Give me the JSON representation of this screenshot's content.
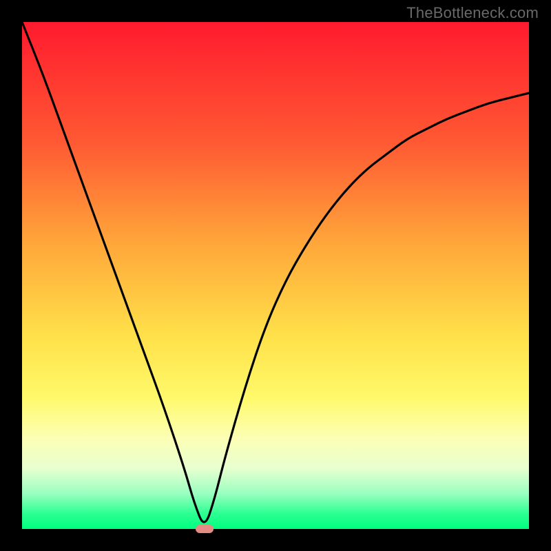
{
  "watermark": "TheBottleneck.com",
  "colors": {
    "frame": "#000000",
    "curve": "#000000",
    "marker": "#e38b84"
  },
  "chart_data": {
    "type": "line",
    "title": "",
    "xlabel": "",
    "ylabel": "",
    "xlim": [
      0,
      100
    ],
    "ylim": [
      0,
      100
    ],
    "grid": false,
    "legend": false,
    "notes": "V-shaped bottleneck curve. The vertical axis roughly reads as mismatch (%) mapped onto a red→green gradient (red top ≈ severe, green bottom ≈ balanced). Minimum sits near x≈36.",
    "series": [
      {
        "name": "bottleneck-curve",
        "x": [
          0,
          4,
          8,
          12,
          16,
          20,
          24,
          28,
          32,
          34,
          36,
          38,
          40,
          44,
          48,
          52,
          56,
          60,
          64,
          68,
          72,
          76,
          80,
          84,
          88,
          92,
          96,
          100
        ],
        "values": [
          100,
          90,
          79,
          68,
          57,
          46,
          35,
          24,
          12,
          5,
          0,
          6,
          14,
          28,
          40,
          49,
          56,
          62,
          67,
          71,
          74,
          77,
          79,
          81,
          82.5,
          84,
          85,
          86
        ]
      }
    ],
    "annotations": [
      {
        "name": "optimal-marker",
        "x": 36,
        "y": 0
      }
    ]
  }
}
